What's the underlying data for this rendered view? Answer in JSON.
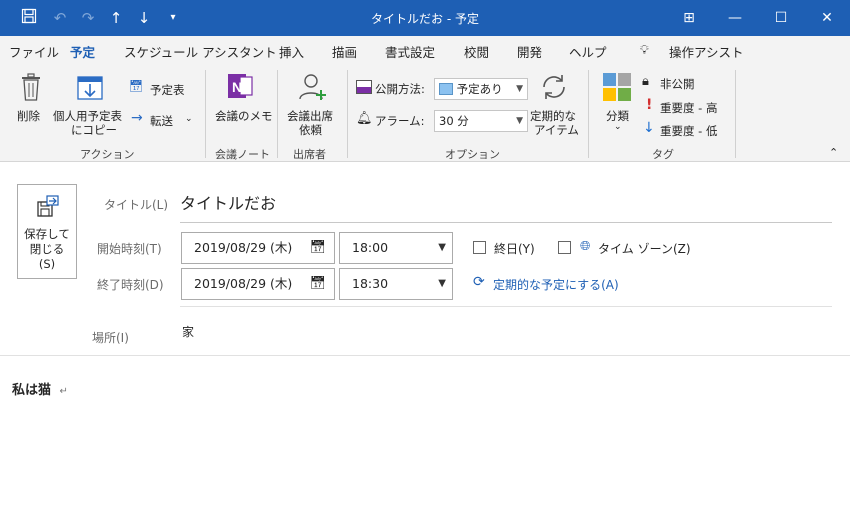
{
  "window": {
    "title": "タイトルだお - 予定",
    "controls": {
      "ribbon_options": "⊞",
      "minimize": "—",
      "maximize": "☐",
      "close": "✕"
    }
  },
  "tabs": [
    {
      "label": "ファイル"
    },
    {
      "label": "予定"
    },
    {
      "label": "スケジュール アシスタント"
    },
    {
      "label": "挿入"
    },
    {
      "label": "描画"
    },
    {
      "label": "書式設定"
    },
    {
      "label": "校閲"
    },
    {
      "label": "開発"
    },
    {
      "label": "ヘルプ"
    },
    {
      "label": "操作アシスト"
    }
  ],
  "ribbon": {
    "actions": {
      "delete": "削除",
      "copy_personal_line1": "個人用予定表",
      "copy_personal_line2": "にコピー",
      "calendar": "予定表",
      "forward": "転送",
      "group": "アクション"
    },
    "meeting_notes": {
      "memo": "会議のメモ",
      "group": "会議ノート"
    },
    "attendees": {
      "line1": "会議出席",
      "line2": "依頼",
      "group": "出席者"
    },
    "options": {
      "show_as_label": "公開方法:",
      "show_as_value": "予定あり",
      "reminder_label": "アラーム:",
      "reminder_value": "30 分",
      "recurring_line1": "定期的な",
      "recurring_line2": "アイテム",
      "group": "オプション"
    },
    "tags": {
      "categorize": "分類",
      "private": "非公開",
      "high": "重要度 - 高",
      "low": "重要度 - 低",
      "group": "タグ"
    }
  },
  "form": {
    "save_close_line1": "保存して",
    "save_close_line2": "閉じる",
    "save_close_line3": "(S)",
    "title_label": "タイトル(L)",
    "title_value": "タイトルだお",
    "start_label": "開始時刻(T)",
    "start_date": "2019/08/29 (木)",
    "start_time": "18:00",
    "end_label": "終了時刻(D)",
    "end_date": "2019/08/29 (木)",
    "end_time": "18:30",
    "all_day": "終日(Y)",
    "time_zones": "タイム ゾーン(Z)",
    "make_recurring": "定期的な予定にする(A)",
    "location_label": "場所(I)",
    "location_value": "家"
  },
  "body": {
    "text": "私は猫",
    "para_mark": "↵"
  },
  "colors": {
    "accent": "#1e5fb4",
    "onenote": "#7b2fa5",
    "importance_high": "#d32f2f",
    "importance_low": "#1e6fd0"
  }
}
